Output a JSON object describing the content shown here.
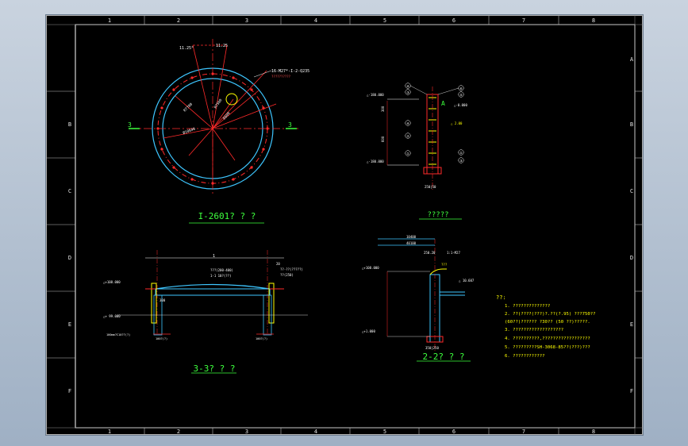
{
  "drawing": {
    "col_numbers": [
      "1",
      "2",
      "3",
      "4",
      "5",
      "6",
      "7",
      "8"
    ],
    "row_letters": [
      "A",
      "B",
      "C",
      "D",
      "E",
      "F"
    ],
    "plan": {
      "title": "I-2601? ? ?",
      "axis_left": "3",
      "axis_right": "3",
      "top_angle_left": "11.25°",
      "top_angle_right": "11.25",
      "callout": "16-M27*-I-2-Q235",
      "callout_sub": "??????????",
      "dims": [
        "R7700",
        "R7500",
        "Ø10840",
        "R600"
      ]
    },
    "section_a": {
      "title": "?????",
      "left_labels": [
        "△-180.000",
        "△-180.000"
      ],
      "dims": [
        "300",
        "600"
      ],
      "right_labels": [
        "①",
        "②",
        "③",
        "④",
        "⑤",
        "⑥",
        "⑦"
      ],
      "small_notes": [
        "△-0.000",
        "△ 2.00",
        "250|50"
      ],
      "mark": "A"
    },
    "section_3": {
      "title": "3-3? ? ?",
      "top_dim": "1",
      "notes_top": [
        "???(200-400)",
        "1-1 10?(??)",
        "??-??(?????)",
        "??(250)"
      ],
      "left_labels": [
        "△+108.000",
        "△+ 99.000"
      ],
      "bottom_notes": [
        "100mm?C10??(?)",
        "100?(?)",
        "100?(?)"
      ],
      "mark_300": "300",
      "mark_20": "20"
    },
    "section_2": {
      "title": "2-2? ? ?",
      "top_notes": [
        "10400",
        "40100"
      ],
      "left_labels": [
        "△+108.000",
        "△+1.000"
      ],
      "right_notes": [
        "1:1-M27",
        "△ 10.607"
      ],
      "dims": [
        "250.20",
        "350|250",
        "???"
      ]
    },
    "notes": {
      "heading": "??:",
      "lines": [
        "1. ??????????????",
        "2. ??(????(???)?.??(?.95)   ???750??",
        "   (60??)?????? ?30?? (50 ??)?????.",
        "3. ???????????????????",
        "4. ??????????,??????????????????",
        "5. ?????????SH-3068-85??(???)???",
        "6. ????????????"
      ]
    }
  }
}
